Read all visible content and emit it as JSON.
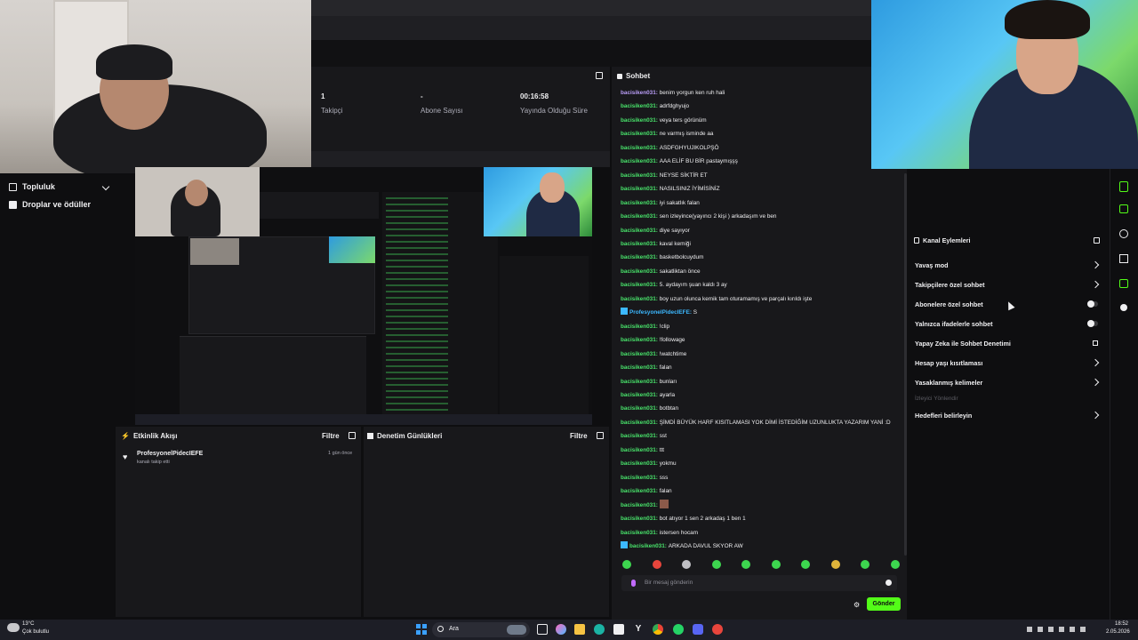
{
  "stats": [
    {
      "value": "1",
      "label": "Takipçi"
    },
    {
      "value": "-",
      "label": "Abone Sayısı"
    },
    {
      "value": "00:16:58",
      "label": "Yayında Olduğu Süre"
    }
  ],
  "nav": {
    "items": [
      {
        "label": "Topluluk"
      },
      {
        "label": "Droplar ve ödüller"
      }
    ]
  },
  "activity": {
    "title": "Etkinlik Akışı",
    "filter": "Filtre",
    "event_user": "ProfesyonelPidecIEFE",
    "event_text": "kanalı takip etti",
    "event_time": "1 gün önce"
  },
  "moderation": {
    "title": "Denetim Günlükleri",
    "filter": "Filtre"
  },
  "chat": {
    "title": "Sohbet",
    "messages": [
      {
        "user": "bacisiken031",
        "text": "benim yorgun ken ruh hali",
        "style": "u2"
      },
      {
        "user": "bacisiken031",
        "text": "adrfdghyujo",
        "style": "u"
      },
      {
        "user": "bacisiken031",
        "text": "veya ters görünüm",
        "style": "u"
      },
      {
        "user": "bacisiken031",
        "text": "ne varmış isminde aa",
        "style": "u"
      },
      {
        "user": "bacisiken031",
        "text": "ASDFGHYUJIKOLPŞÖ",
        "style": "u"
      },
      {
        "user": "bacisiken031",
        "text": "AAA ELİF BU BİR pastaymışşş",
        "style": "u"
      },
      {
        "user": "bacisiken031",
        "text": "NEYSE SİKTİR ET",
        "style": "u"
      },
      {
        "user": "bacisiken031",
        "text": "NASILSINIZ İYİMİSİNİZ",
        "style": "u"
      },
      {
        "user": "bacisiken031",
        "text": "iyi sakatlık falan",
        "style": "u"
      },
      {
        "user": "bacisiken031",
        "text": "sen izleyince(yayıncı 2 kişi ) arkadaşım ve ben",
        "style": "u"
      },
      {
        "user": "bacisiken031",
        "text": "diye sayıyor",
        "style": "u"
      },
      {
        "user": "bacisiken031",
        "text": "kaval kemiği",
        "style": "u"
      },
      {
        "user": "bacisiken031",
        "text": "basketbolcuydum",
        "style": "u"
      },
      {
        "user": "bacisiken031",
        "text": "sakatliktan önce",
        "style": "u"
      },
      {
        "user": "bacisiken031",
        "text": "5. aydayım şuan kaldı 3 ay",
        "style": "u"
      },
      {
        "user": "bacisiken031",
        "text": "boy uzun olunca kemik tam oturamamış ve parçalı kırıldı işte",
        "style": "u"
      },
      {
        "user": "ProfesyonelPidecIEFE",
        "text": "S",
        "style": "u3"
      },
      {
        "user": "bacisiken031",
        "text": "!clip",
        "style": "u"
      },
      {
        "user": "bacisiken031",
        "text": "!followage",
        "style": "u"
      },
      {
        "user": "bacisiken031",
        "text": "!watchtime",
        "style": "u"
      },
      {
        "user": "bacisiken031",
        "text": "falan",
        "style": "u"
      },
      {
        "user": "bacisiken031",
        "text": "bunları",
        "style": "u"
      },
      {
        "user": "bacisiken031",
        "text": "ayarla",
        "style": "u"
      },
      {
        "user": "bacisiken031",
        "text": "botbtan",
        "style": "u"
      },
      {
        "user": "bacisiken031",
        "text": "ŞİMDİ BÜYÜK HARF KISITLAMASI YOK DİMİ İSTEDİĞİM UZUNLUKTA YAZARIM YANİ :D",
        "style": "u"
      },
      {
        "user": "bacisiken031",
        "text": "sst",
        "style": "u"
      },
      {
        "user": "bacisiken031",
        "text": "ttt",
        "style": "u"
      },
      {
        "user": "bacisiken031",
        "text": "yokmu",
        "style": "u"
      },
      {
        "user": "bacisiken031",
        "text": "sss",
        "style": "u"
      },
      {
        "user": "bacisiken031",
        "text": "falan",
        "style": "u"
      },
      {
        "user": "bacisiken031",
        "text": "",
        "style": "u"
      },
      {
        "user": "bacisiken031",
        "text": "bot atıyor 1 sen 2 arkadaş 1 ben 1",
        "style": "u"
      },
      {
        "user": "bacisiken031",
        "text": "istersen hocam",
        "style": "u"
      },
      {
        "user": "bacisiken031",
        "text": "ARKADA DAVUL SKYOR AW",
        "style": "u"
      }
    ],
    "input_placeholder": "Bir mesaj gönderin",
    "send_label": "Gönder",
    "emote_color": "#3dd64f"
  },
  "channel_actions": {
    "title": "Kanal Eylemleri",
    "items": [
      {
        "label": "Yavaş mod",
        "control": "chevron"
      },
      {
        "label": "Takipçilere özel sohbet",
        "control": "chevron"
      },
      {
        "label": "Abonelere özel sohbet",
        "control": "toggle"
      },
      {
        "label": "Yalnızca ifadelerle sohbet",
        "control": "toggle"
      },
      {
        "label": "Yapay Zeka ile Sohbet Denetimi",
        "control": "external"
      },
      {
        "label": "Hesap yaşı kısıtlaması",
        "control": "chevron"
      },
      {
        "label": "Yasaklanmış kelimeler",
        "control": "chevron"
      }
    ],
    "muted_item": "İzleyici Yönlendir",
    "last_item": "Hedefleri belirleyin"
  },
  "taskbar": {
    "weather_temp": "13°C",
    "weather_desc": "Çok bulutlu",
    "search": "Ara",
    "time": "18:52",
    "date": "2.05.2026"
  },
  "colors": {
    "accent_green": "#48e26a",
    "send_button": "#53fc18",
    "background": "#0e0e10"
  }
}
